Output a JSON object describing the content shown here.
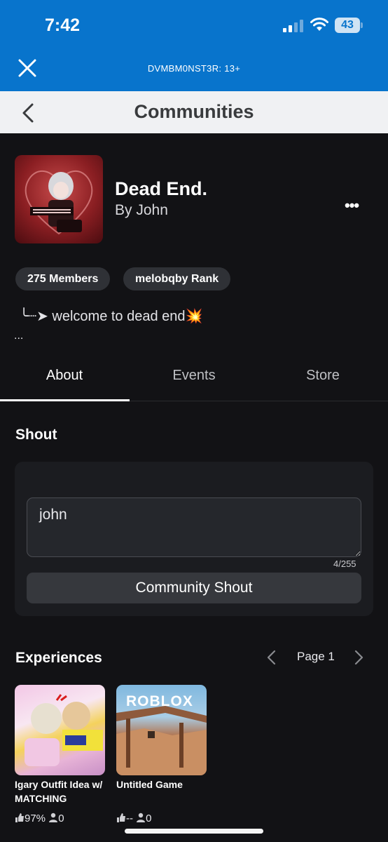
{
  "status_bar": {
    "time": "7:42",
    "battery": "43"
  },
  "top_bar": {
    "title": "DVMBM0NST3R: 13+"
  },
  "nav": {
    "title": "Communities"
  },
  "community": {
    "name": "Dead End.",
    "owner": "By John",
    "chips": [
      "275 Members",
      "melobqby Rank"
    ],
    "description": "╰┈➤ welcome to dead end💥",
    "description_more": "..."
  },
  "tabs": [
    {
      "label": "About",
      "active": true
    },
    {
      "label": "Events",
      "active": false
    },
    {
      "label": "Store",
      "active": false
    }
  ],
  "shout": {
    "title": "Shout",
    "input_value": "john",
    "counter": "4/255",
    "button_label": "Community Shout"
  },
  "experiences": {
    "title": "Experiences",
    "page_label": "Page 1",
    "games": [
      {
        "name": "Igary Outfit Idea w/ MATCHING OUTFITS",
        "rating": "97%",
        "players": "0"
      },
      {
        "name": "Untitled Game",
        "rating": "--",
        "players": "0",
        "thumb_text": "ROBLOX"
      }
    ]
  }
}
